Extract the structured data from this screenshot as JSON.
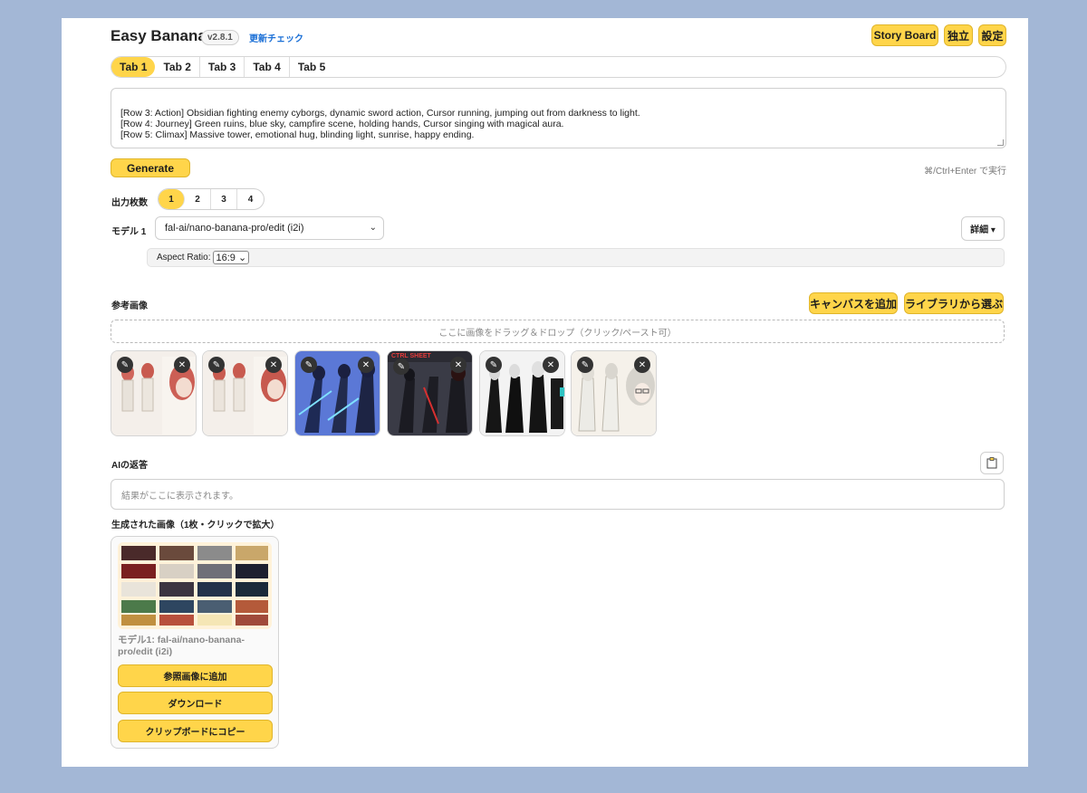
{
  "header": {
    "app_title": "Easy Banana",
    "version": "v2.8.1",
    "update_check": "更新チェック",
    "story_board": "Story Board",
    "standalone": "独立",
    "settings": "設定"
  },
  "tabs": [
    {
      "label": "Tab 1",
      "active": true
    },
    {
      "label": "Tab 2",
      "active": false
    },
    {
      "label": "Tab 3",
      "active": false
    },
    {
      "label": "Tab 4",
      "active": false
    },
    {
      "label": "Tab 5",
      "active": false
    }
  ],
  "prompt": {
    "text": "[Row 3: Action] Obsidian fighting enemy cyborgs, dynamic sword action, Cursor running, jumping out from darkness to light.\n[Row 4: Journey] Green ruins, blue sky, campfire scene, holding hands, Cursor singing with magical aura.\n[Row 5: Climax] Massive tower, emotional hug, blinding light, sunrise, happy ending.\n\nStyle: rough sketch, distinct lineart, ink wash, numbered panels, annotated, cinematic composition, dramatic lighting, color grading from dark blue to bright gold."
  },
  "generate": {
    "label": "Generate",
    "shortcut": "⌘/Ctrl+Enter で実行"
  },
  "output_count": {
    "label": "出力枚数",
    "options": [
      "1",
      "2",
      "3",
      "4"
    ],
    "selected": "1"
  },
  "model": {
    "label": "モデル 1",
    "value": "fal-ai/nano-banana-pro/edit (i2i)",
    "detail_label": "詳細 ▾"
  },
  "aspect": {
    "label": "Aspect Ratio:",
    "value": "16:9 ⌄"
  },
  "reference": {
    "label": "参考画像",
    "add_canvas": "キャンバスを追加",
    "choose_library": "ライブラリから選ぶ",
    "dropzone": "ここに画像をドラッグ＆ドロップ（クリック/ペースト可）",
    "thumb_labels": [
      "CTRL SHEET"
    ],
    "thumbnails": [
      {
        "bg": "#f4efea",
        "accent": "#d0665c"
      },
      {
        "bg": "#f4efea",
        "accent": "#c85a4f"
      },
      {
        "bg": "#5b78d6",
        "accent": "#1e2a55"
      },
      {
        "bg": "#3a3b46",
        "accent": "#c82828"
      },
      {
        "bg": "#f3f3f3",
        "accent": "#141414"
      },
      {
        "bg": "#f5f1ea",
        "accent": "#d9d6cf"
      }
    ]
  },
  "ai": {
    "label": "AIの返答",
    "placeholder": "結果がここに表示されます。",
    "copy_icon": "clipboard-icon"
  },
  "generated": {
    "label": "生成された画像（1枚・クリックで拡大）",
    "caption": "モデル1: fal-ai/nano-banana-pro/edit (i2i)",
    "add_ref": "参照画像に追加",
    "download": "ダウンロード",
    "copy": "クリップボードにコピー"
  },
  "colors": {
    "accent": "#ffd54a",
    "page_bg": "#a3b7d6"
  }
}
